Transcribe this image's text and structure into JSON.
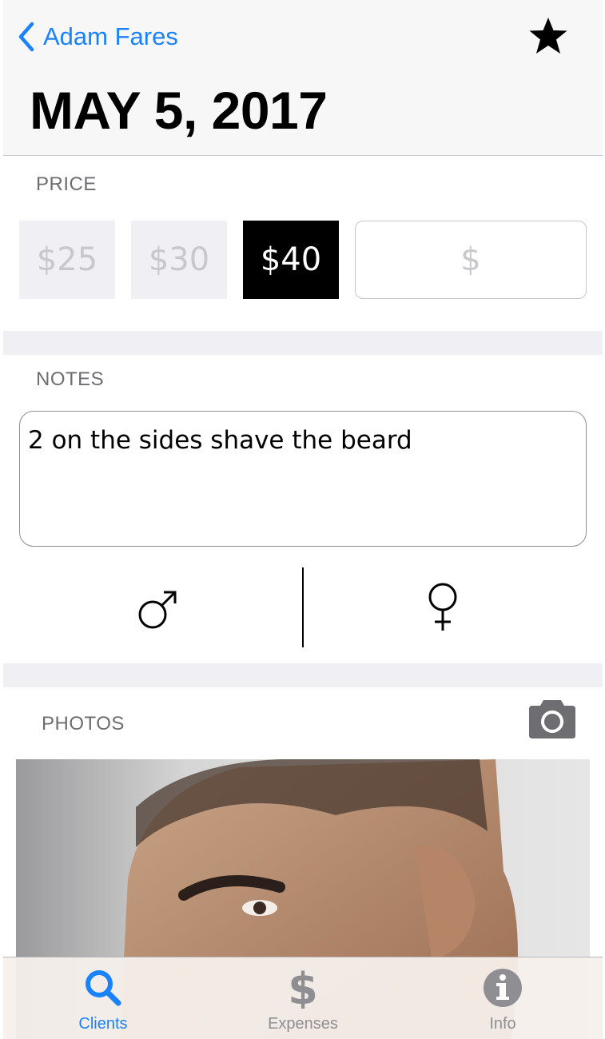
{
  "header": {
    "back_label": "Adam Fares",
    "title": "MAY 5, 2017"
  },
  "price": {
    "label": "PRICE",
    "options": [
      "$25",
      "$30",
      "$40"
    ],
    "selected": "$40",
    "custom_placeholder": "$"
  },
  "notes": {
    "label": "NOTES",
    "value": "2 on the sides shave the beard"
  },
  "photos": {
    "label": "PHOTOS"
  },
  "tabs": [
    {
      "label": "Clients",
      "icon": "search-icon",
      "active": true
    },
    {
      "label": "Expenses",
      "icon": "dollar-icon",
      "active": false
    },
    {
      "label": "Info",
      "icon": "info-icon",
      "active": false
    }
  ],
  "colors": {
    "accent": "#1a82fb",
    "selected_price_bg": "#000000",
    "inactive_price_bg": "#efeff4"
  }
}
